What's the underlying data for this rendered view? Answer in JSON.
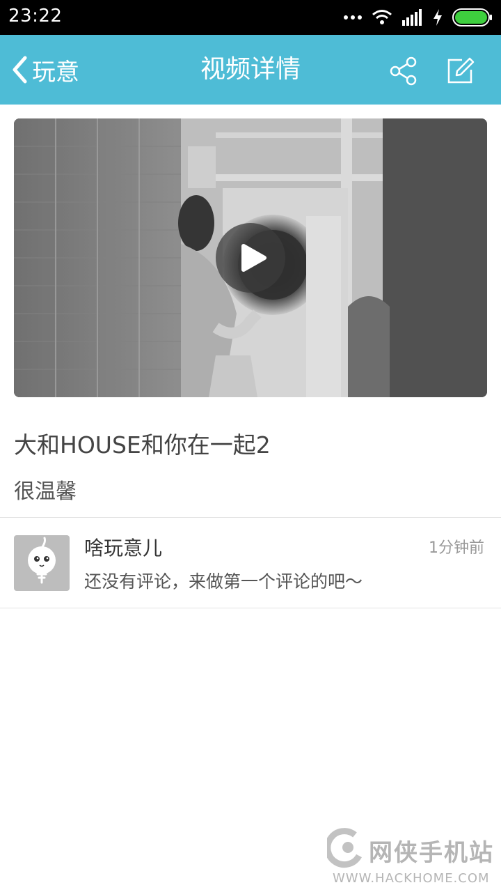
{
  "status_bar": {
    "time": "23:22",
    "icons": [
      "more-dots-icon",
      "wifi-icon",
      "signal-icon",
      "charging-icon",
      "battery-icon"
    ]
  },
  "nav": {
    "back_label": "玩意",
    "title": "视频详情",
    "share_icon": "share-icon",
    "edit_icon": "edit-icon",
    "background_color": "#4ebcd6"
  },
  "video": {
    "play_icon": "play-icon"
  },
  "content": {
    "title": "大和HOUSE和你在一起2",
    "description": "很温馨"
  },
  "comment": {
    "author": "啥玩意儿",
    "time": "1分钟前",
    "text": "还没有评论，来做第一个评论的吧～"
  },
  "watermark": {
    "name": "网侠手机站",
    "url": "WWW.HACKHOME.COM"
  }
}
